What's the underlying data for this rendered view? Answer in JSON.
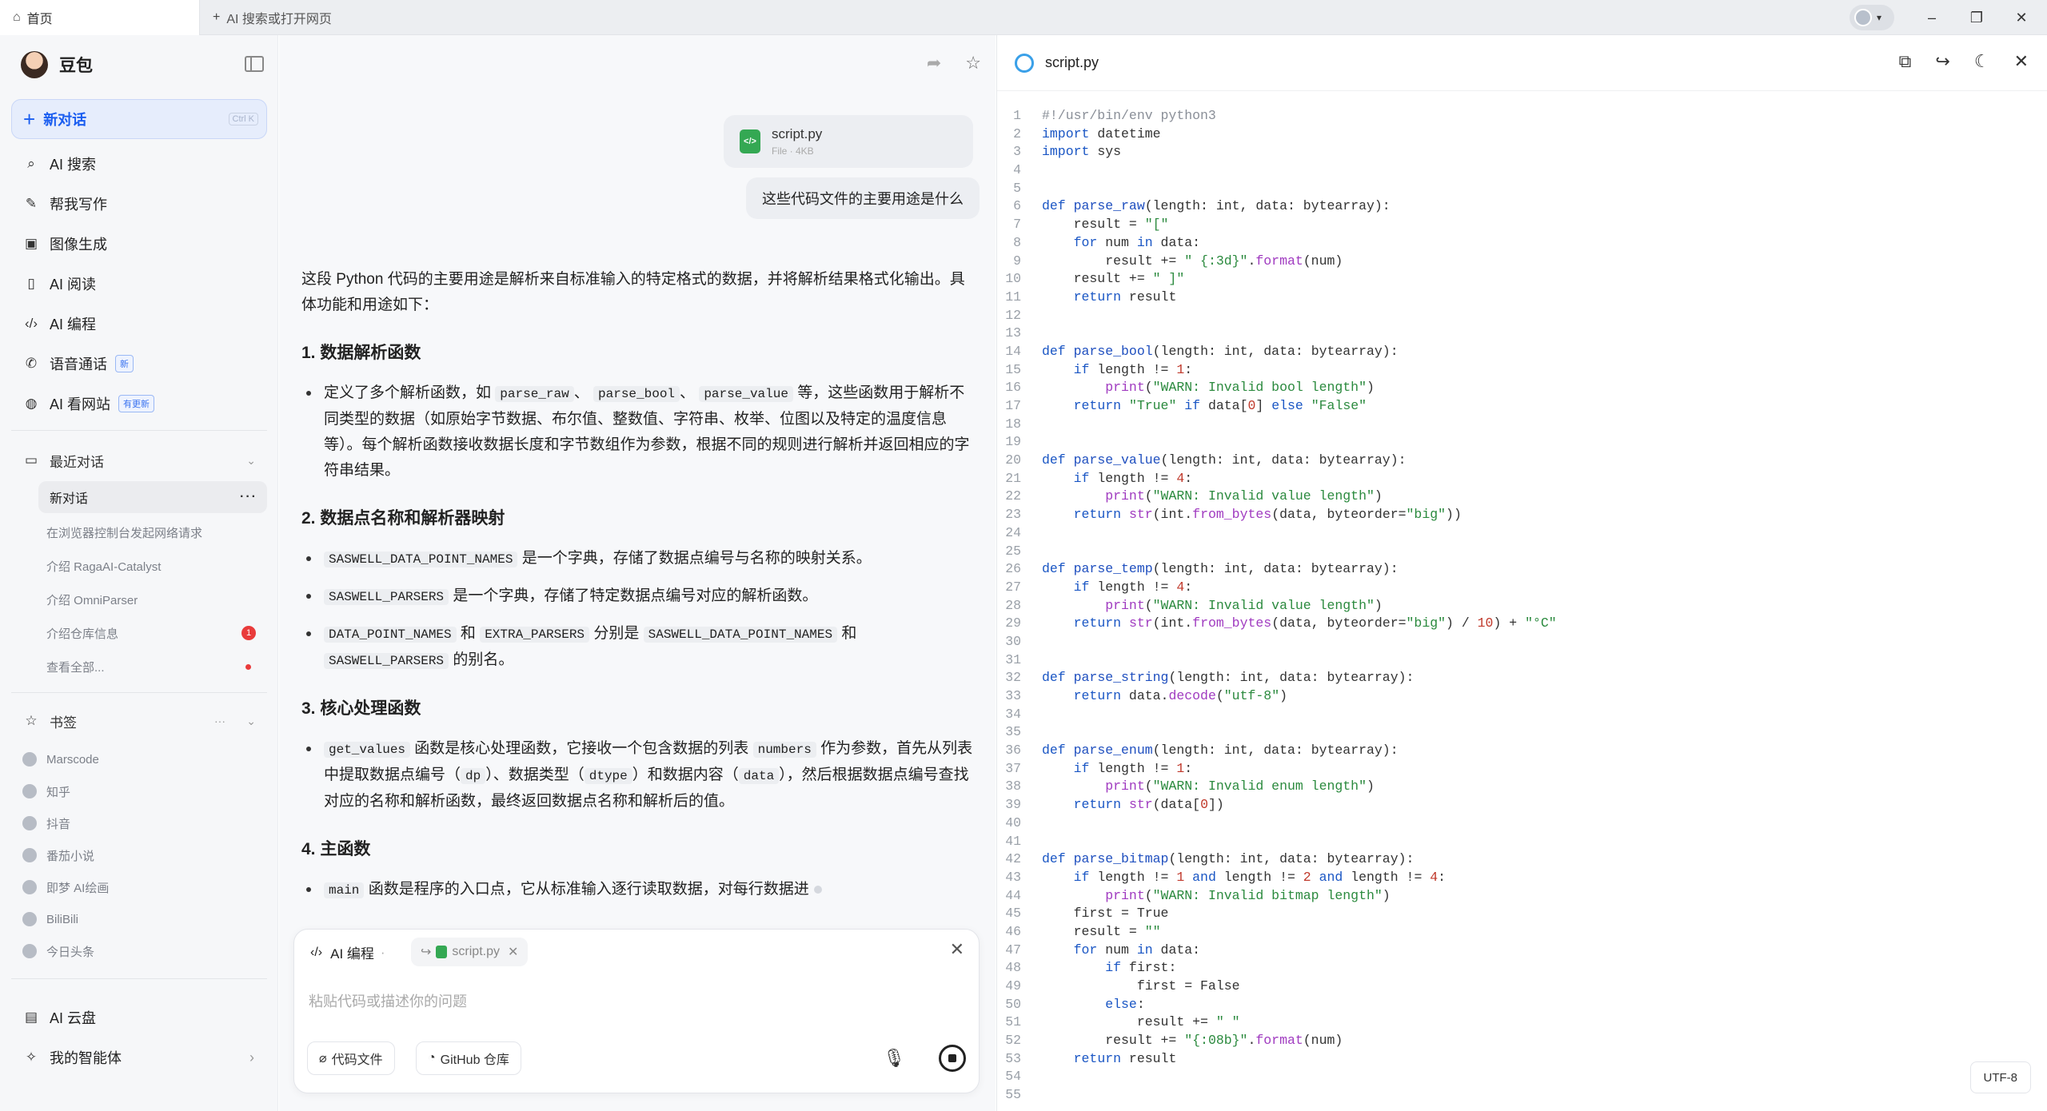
{
  "tabs": [
    {
      "label": "首页"
    },
    {
      "label": "AI 搜索或打开网页"
    }
  ],
  "window": {
    "minimize": "–",
    "maximize": "❐",
    "close": "✕"
  },
  "sidebar": {
    "brand": "豆包",
    "new_chat": "新对话",
    "new_chat_shortcut": "Ctrl K",
    "nav": [
      {
        "label": "AI 搜索",
        "icon": "search-icon"
      },
      {
        "label": "帮我写作",
        "icon": "pen-icon"
      },
      {
        "label": "图像生成",
        "icon": "image-icon"
      },
      {
        "label": "AI 阅读",
        "icon": "book-icon"
      },
      {
        "label": "AI 编程",
        "icon": "code-icon"
      },
      {
        "label": "语音通话",
        "icon": "phone-icon",
        "badge": "新"
      },
      {
        "label": "AI 看网站",
        "icon": "globe-icon",
        "badge": "有更新"
      }
    ],
    "recent_title": "最近对话",
    "recent": [
      {
        "label": "新对话",
        "active": true
      },
      {
        "label": "在浏览器控制台发起网络请求"
      },
      {
        "label": "介绍 RagaAI-Catalyst"
      },
      {
        "label": "介绍 OmniParser"
      },
      {
        "label": "介绍仓库信息",
        "badge": "1"
      },
      {
        "label": "查看全部...",
        "dot": true
      }
    ],
    "bookmarks_title": "书签",
    "bookmarks": [
      "Marscode",
      "知乎",
      "抖音",
      "番茄小说",
      "即梦 AI绘画",
      "BiliBili",
      "今日头条"
    ],
    "cloud": "AI 云盘",
    "agents": "我的智能体"
  },
  "chat": {
    "file": {
      "name": "script.py",
      "meta": "File · 4KB"
    },
    "question": "这些代码文件的主要用途是什么",
    "answer": {
      "intro": "这段 Python 代码的主要用途是解析来自标准输入的特定格式的数据，并将解析结果格式化输出。具体功能和用途如下：",
      "s1_title": "1. 数据解析函数",
      "s1_a": "定义了多个解析函数，如",
      "s1_c1": "parse_raw",
      "s1_sep1": "、",
      "s1_c2": "parse_bool",
      "s1_sep2": "、",
      "s1_c3": "parse_value",
      "s1_b": "等，这些函数用于解析不同类型的数据（如原始字节数据、布尔值、整数值、字符串、枚举、位图以及特定的温度信息等）。每个解析函数接收数据长度和字节数组作为参数，根据不同的规则进行解析并返回相应的字符串结果。",
      "s2_title": "2. 数据点名称和解析器映射",
      "s2_c1": "SASWELL_DATA_POINT_NAMES",
      "s2_t1": "是一个字典，存储了数据点编号与名称的映射关系。",
      "s2_c2": "SASWELL_PARSERS",
      "s2_t2": "是一个字典，存储了特定数据点编号对应的解析函数。",
      "s2_c3": "DATA_POINT_NAMES",
      "s2_t3a": "和",
      "s2_c4": "EXTRA_PARSERS",
      "s2_t3b": "分别是",
      "s2_c5": "SASWELL_DATA_POINT_NAMES",
      "s2_t3c": "和",
      "s2_c6": "SASWELL_PARSERS",
      "s2_t3d": "的别名。",
      "s3_title": "3. 核心处理函数",
      "s3_c1": "get_values",
      "s3_t1": "函数是核心处理函数，它接收一个包含数据的列表",
      "s3_c2": "numbers",
      "s3_t2": "作为参数，首先从列表中提取数据点编号（",
      "s3_c3": "dp",
      "s3_t3": "）、数据类型（",
      "s3_c4": "dtype",
      "s3_t4": "）和数据内容（",
      "s3_c5": "data",
      "s3_t5": "），然后根据数据点编号查找对应的名称和解析函数，最终返回数据点名称和解析后的值。",
      "s4_title": "4. 主函数",
      "s4_c1": "main",
      "s4_t1": "函数是程序的入口点，它从标准输入逐行读取数据，对每行数据进"
    }
  },
  "input": {
    "mode": "AI 编程",
    "chip": "script.py",
    "placeholder": "粘贴代码或描述你的问题",
    "btn_code": "代码文件",
    "btn_github": "GitHub 仓库"
  },
  "code_panel": {
    "title": "script.py",
    "encoding": "UTF-8"
  }
}
